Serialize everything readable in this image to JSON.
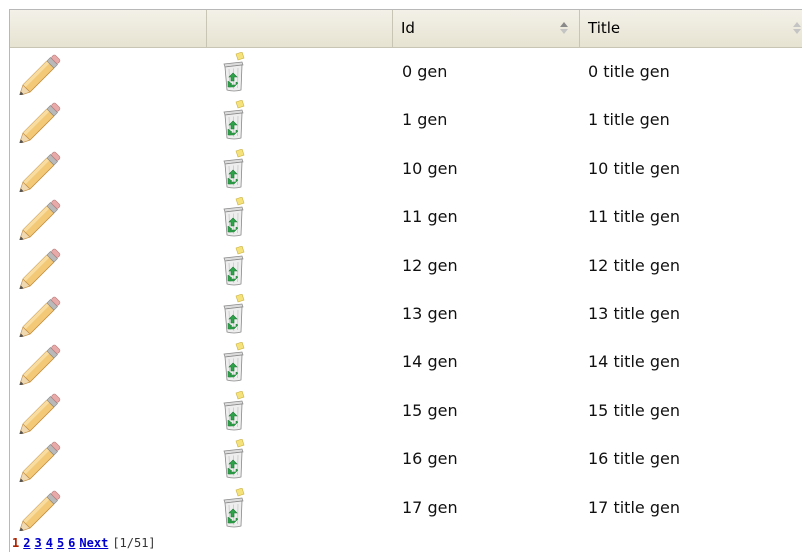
{
  "table": {
    "columns": [
      {
        "label": ""
      },
      {
        "label": ""
      },
      {
        "label": "Id"
      },
      {
        "label": "Title"
      }
    ],
    "rows": [
      {
        "id": "0 gen",
        "title": "0 title gen"
      },
      {
        "id": "1 gen",
        "title": "1 title gen"
      },
      {
        "id": "10 gen",
        "title": "10 title gen"
      },
      {
        "id": "11 gen",
        "title": "11 title gen"
      },
      {
        "id": "12 gen",
        "title": "12 title gen"
      },
      {
        "id": "13 gen",
        "title": "13 title gen"
      },
      {
        "id": "14 gen",
        "title": "14 title gen"
      },
      {
        "id": "15 gen",
        "title": "15 title gen"
      },
      {
        "id": "16 gen",
        "title": "16 title gen"
      },
      {
        "id": "17 gen",
        "title": "17 title gen"
      }
    ],
    "row_icons": {
      "edit": "pencil-icon",
      "delete": "trash-can-icon"
    }
  },
  "pager": {
    "current": "1",
    "pages": [
      "2",
      "3",
      "4",
      "5",
      "6"
    ],
    "next_label": "Next",
    "count": "[1/51]"
  },
  "colors": {
    "header_bg": "#ebe8d8",
    "link": "#0000cc",
    "current_page": "#aa2200"
  }
}
